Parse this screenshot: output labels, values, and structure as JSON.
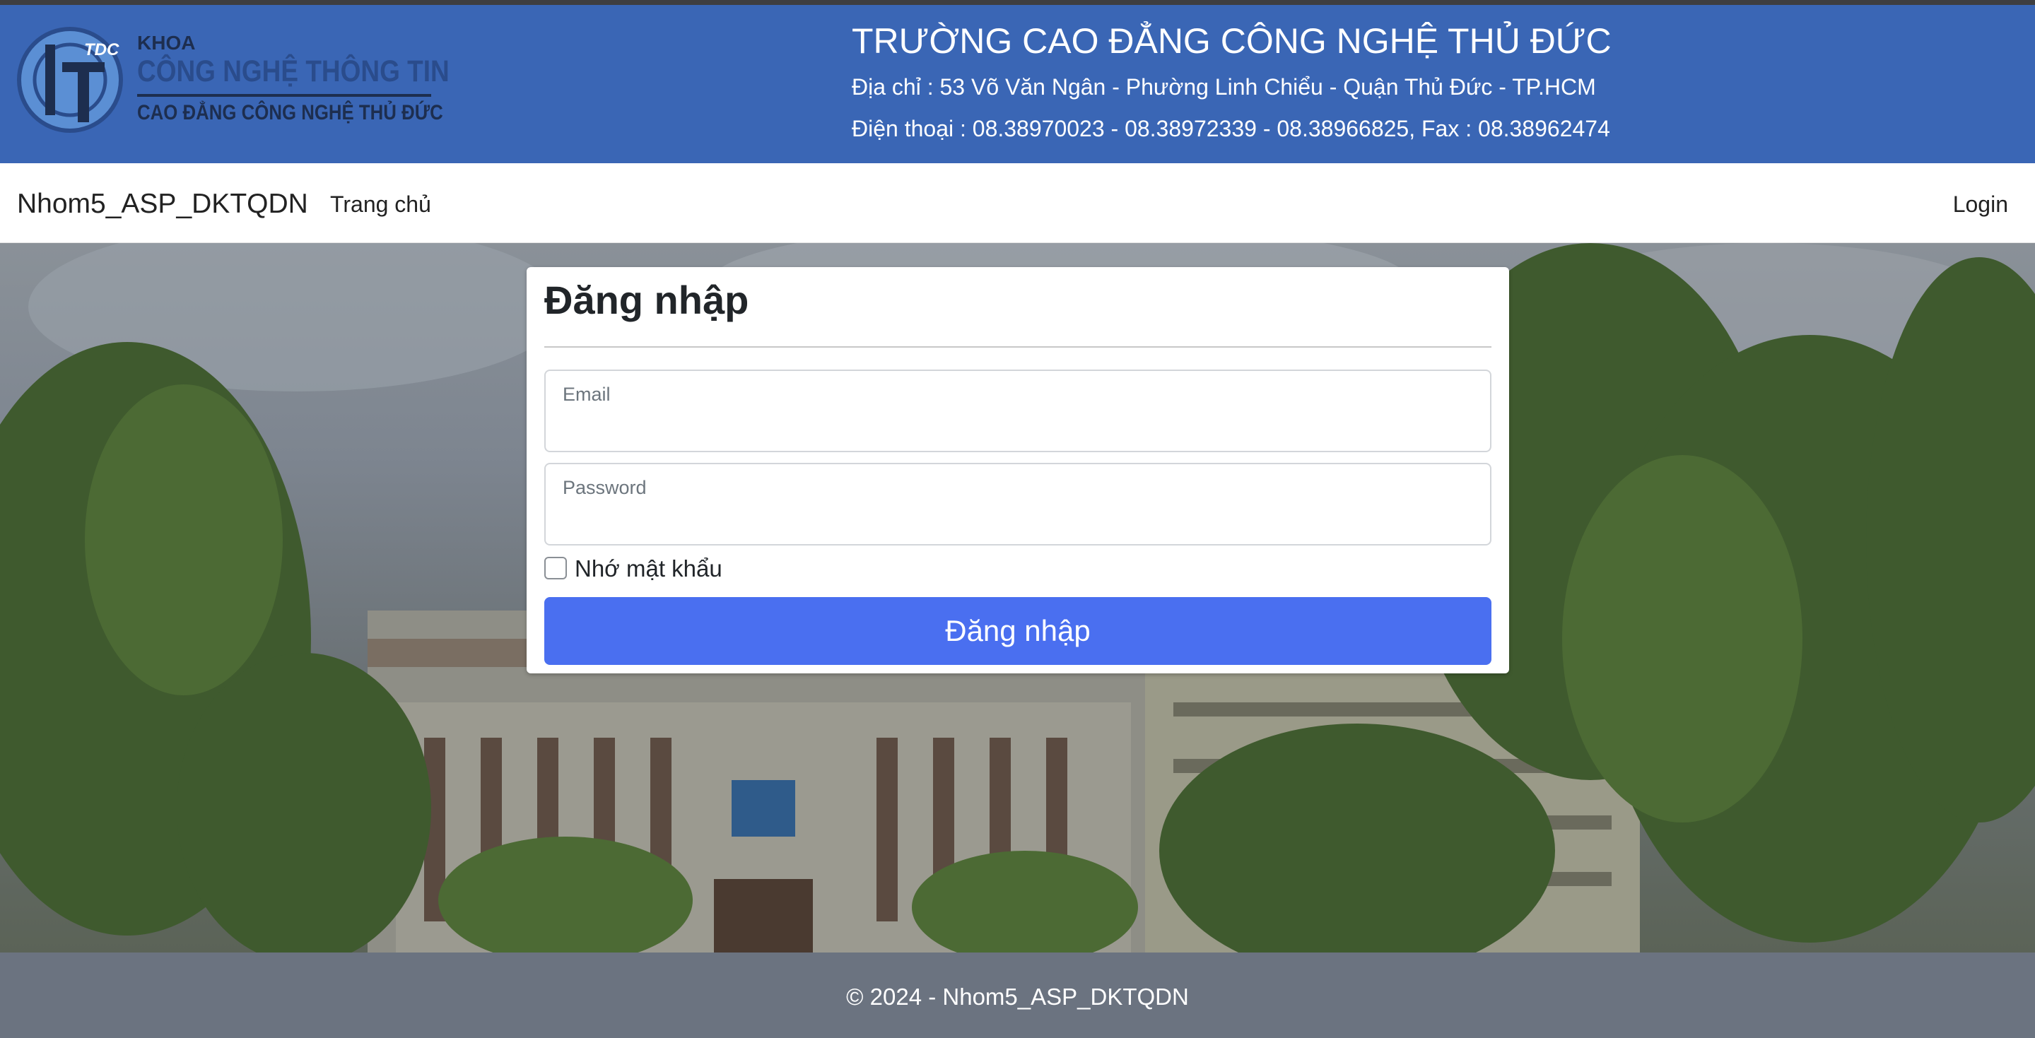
{
  "header": {
    "logo_line1": "KHOA",
    "logo_line2": "CÔNG NGHỆ THÔNG TIN",
    "logo_line3": "CAO ĐẲNG CÔNG NGHỆ THỦ ĐỨC",
    "logo_badge": "TDC",
    "school_name": "TRƯỜNG CAO ĐẲNG CÔNG NGHỆ THỦ ĐỨC",
    "address": "Địa chỉ : 53 Võ Văn Ngân - Phường Linh Chiểu - Quận Thủ Đức - TP.HCM",
    "phone": "Điện thoại : 08.38970023 - 08.38972339 - 08.38966825, Fax : 08.38962474"
  },
  "navbar": {
    "brand": "Nhom5_ASP_DKTQDN",
    "home": "Trang chủ",
    "login": "Login"
  },
  "login_form": {
    "title": "Đăng nhập",
    "email_label": "Email",
    "email_value": "",
    "password_label": "Password",
    "password_value": "",
    "remember_label": "Nhớ mật khẩu",
    "remember_checked": false,
    "submit_label": "Đăng nhập"
  },
  "footer": {
    "text": "© 2024 - Nhom5_ASP_DKTQDN"
  },
  "colors": {
    "banner": "#3a66b5",
    "primary_button": "#4a6ff0",
    "footer": "#6b7380"
  }
}
